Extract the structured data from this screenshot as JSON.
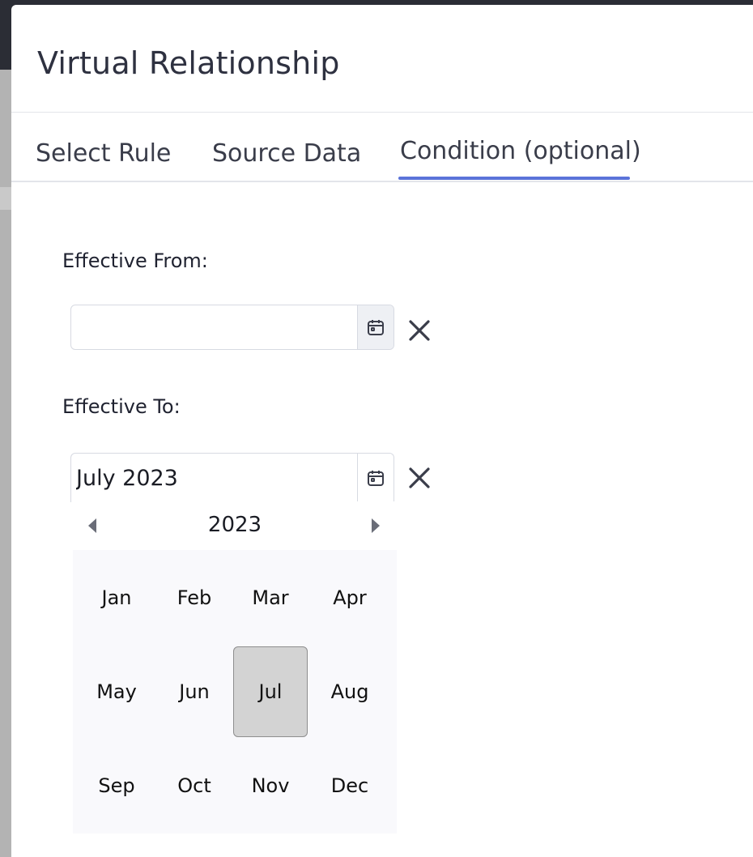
{
  "dialog": {
    "title": "Virtual Relationship"
  },
  "tabs": [
    {
      "label": "Select Rule"
    },
    {
      "label": "Source Data"
    },
    {
      "label": "Condition (optional)",
      "active": true
    }
  ],
  "form": {
    "effective_from": {
      "label": "Effective From:",
      "value": ""
    },
    "effective_to": {
      "label": "Effective To:",
      "value": "July 2023"
    }
  },
  "month_picker": {
    "year": "2023",
    "months": [
      "Jan",
      "Feb",
      "Mar",
      "Apr",
      "May",
      "Jun",
      "Jul",
      "Aug",
      "Sep",
      "Oct",
      "Nov",
      "Dec"
    ],
    "selected": "Jul"
  },
  "icons": {
    "calendar": "calendar-icon",
    "clear": "close-icon",
    "prev": "caret-left-icon",
    "next": "caret-right-icon"
  },
  "colors": {
    "accent": "#5b73d9",
    "selected_month_bg": "#d3d3d3",
    "title_text": "#2e3140"
  }
}
